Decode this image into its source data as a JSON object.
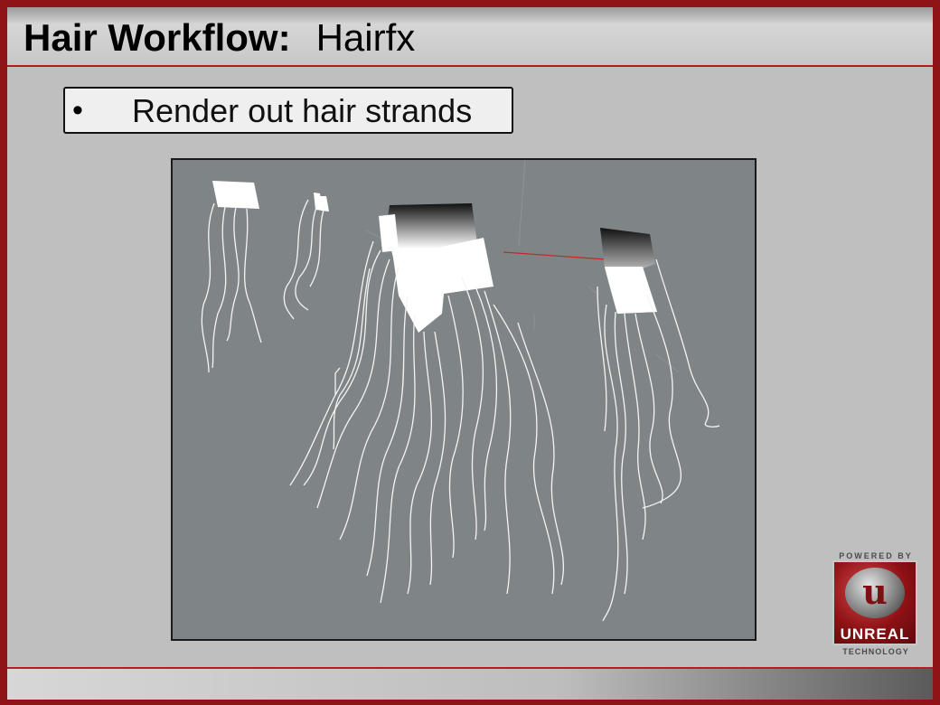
{
  "slide": {
    "title_main": "Hair Workflow:",
    "title_sub": "Hairfx",
    "bullet": "•",
    "bullet_text": "Render out hair strands"
  },
  "logo": {
    "powered": "POWERED BY",
    "letter": "u",
    "word": "UNREAL",
    "tech": "TECHNOLOGY"
  },
  "colors": {
    "frame": "#8f1418",
    "accent_line": "#b31e22",
    "background": "#bfbfbf",
    "viewport": "#7f8587"
  }
}
